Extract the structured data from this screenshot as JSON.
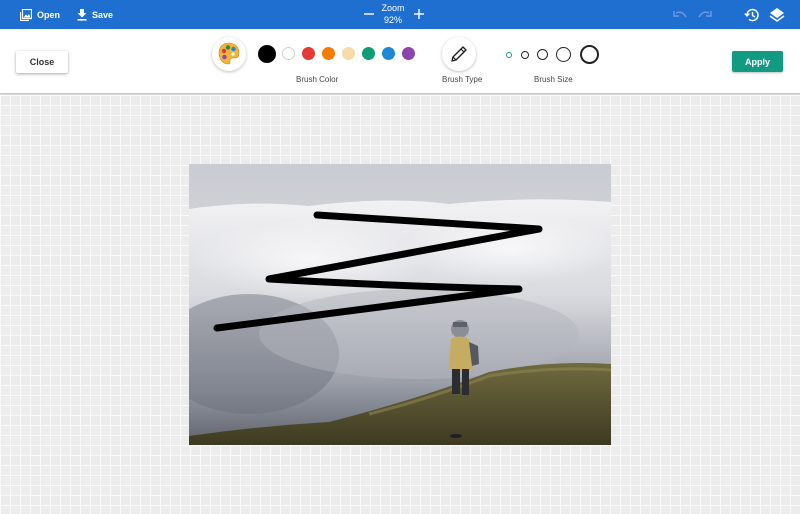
{
  "topbar": {
    "open_label": "Open",
    "save_label": "Save",
    "zoom_label": "Zoom",
    "zoom_value": "92%",
    "icons": [
      "image-icon",
      "download-icon",
      "zoom-out-icon",
      "zoom-in-icon",
      "undo-icon",
      "redo-icon",
      "history-icon",
      "layers-icon"
    ]
  },
  "toolbar": {
    "close_label": "Close",
    "apply_label": "Apply",
    "brush_color_label": "Brush Color",
    "brush_type_label": "Brush Type",
    "brush_size_label": "Brush Size",
    "colors": [
      "#000000",
      "#ffffff",
      "#e53935",
      "#f57c00",
      "#f5dca8",
      "#0f9d76",
      "#1e88d6",
      "#8e44ad"
    ],
    "selected_color": "#000000",
    "accent_color": "#139a83",
    "brush_sizes": [
      "xs",
      "s",
      "m",
      "l",
      "xl"
    ],
    "selected_size": "xs"
  },
  "colors": {
    "topbar": "#1e6fd0",
    "apply": "#139a83"
  }
}
